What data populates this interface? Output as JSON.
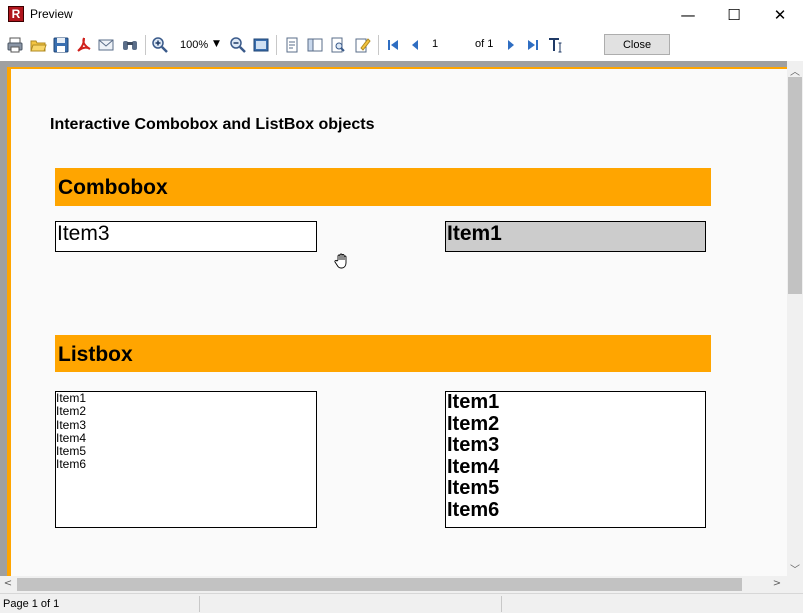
{
  "window": {
    "title": "Preview",
    "app_icon_letter": "R",
    "minimize": "—",
    "maximize": "☐",
    "close": "✕"
  },
  "toolbar": {
    "zoom_value": "100%",
    "current_page": "1",
    "page_count_label": "of 1",
    "close_label": "Close",
    "icons": [
      "print-icon",
      "open-icon",
      "save-icon",
      "pdf-export-icon",
      "email-icon",
      "find-icon",
      "zoom-in-icon",
      "zoom-out-icon",
      "full-screen-icon",
      "page-setup-icon",
      "outline-icon",
      "thumbnails-icon",
      "edit-icon",
      "first-page-icon",
      "prev-page-icon",
      "next-page-icon",
      "last-page-icon",
      "text-tool-icon"
    ]
  },
  "report": {
    "heading": "Interactive Combobox and ListBox objects",
    "combobox_section_label": "Combobox",
    "combobox_left_value": "Item3",
    "combobox_right_value": "Item1",
    "listbox_section_label": "Listbox",
    "listbox_left_items": [
      "Item1",
      "Item2",
      "Item3",
      "Item4",
      "Item5",
      "Item6"
    ],
    "listbox_right_items": [
      "Item1",
      "Item2",
      "Item3",
      "Item4",
      "Item5",
      "Item6"
    ]
  },
  "colors": {
    "band": "#ffa500",
    "combo_highlight": "#cccccc"
  },
  "statusbar": {
    "page_info": "Page 1 of 1"
  }
}
